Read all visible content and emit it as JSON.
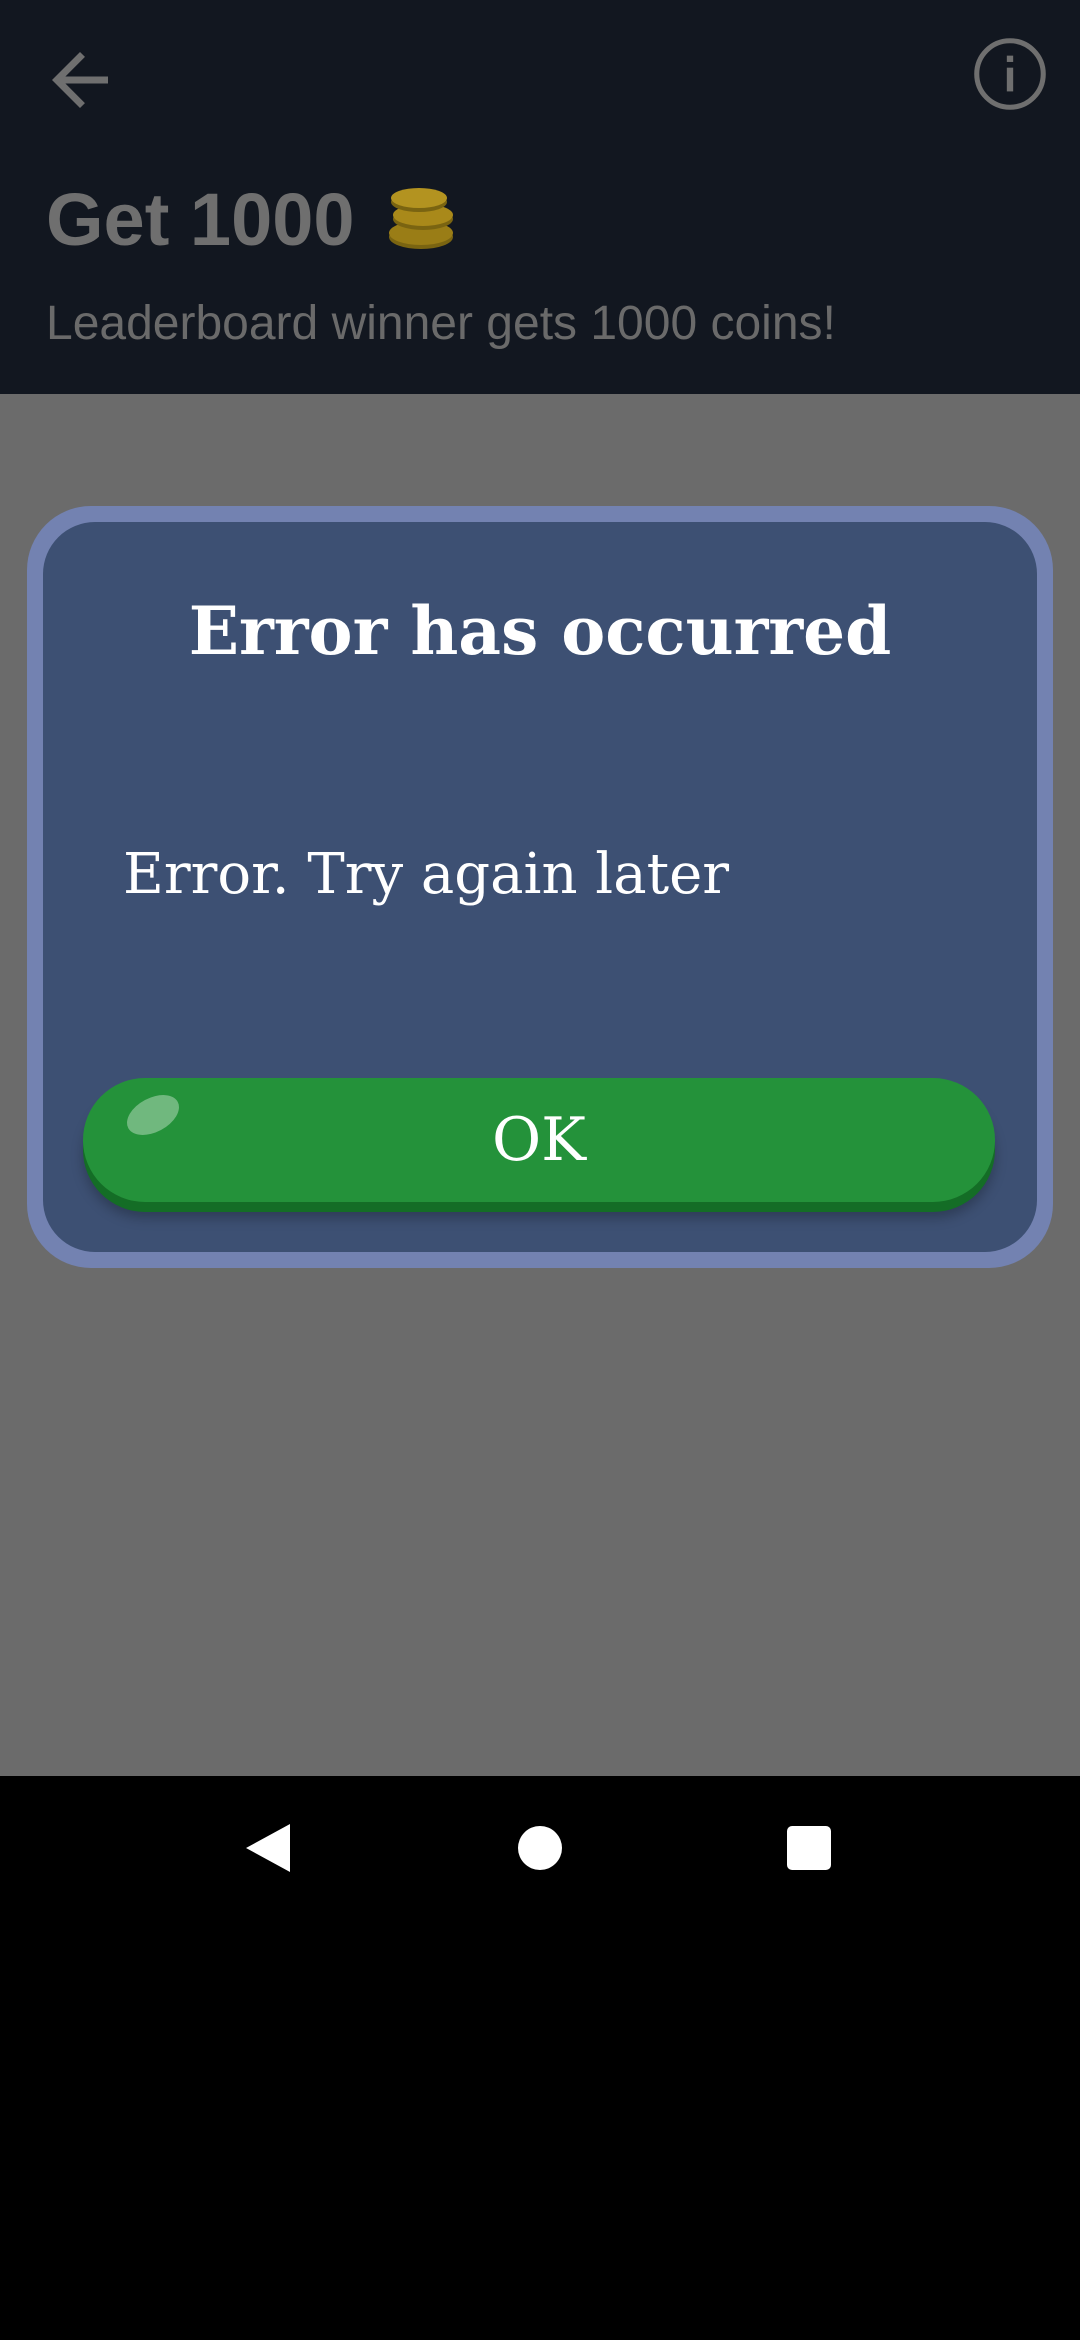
{
  "header": {
    "title": "Get 1000",
    "subtitle": "Leaderboard winner gets 1000 coins!",
    "back_icon": "arrow-back-icon",
    "info_icon": "info-icon",
    "coin_icon": "coins-icon"
  },
  "dialog": {
    "title": "Error has occurred",
    "message": "Error. Try again later",
    "ok_label": "OK"
  },
  "colors": {
    "header_bg": "#121720",
    "overlay": "#6b6b6b",
    "dialog_border": "#7382b1",
    "dialog_bg": "#3d5073",
    "ok_button": "#24923a"
  },
  "navbar": {
    "back_icon": "nav-back-icon",
    "home_icon": "nav-home-icon",
    "recents_icon": "nav-recents-icon"
  }
}
